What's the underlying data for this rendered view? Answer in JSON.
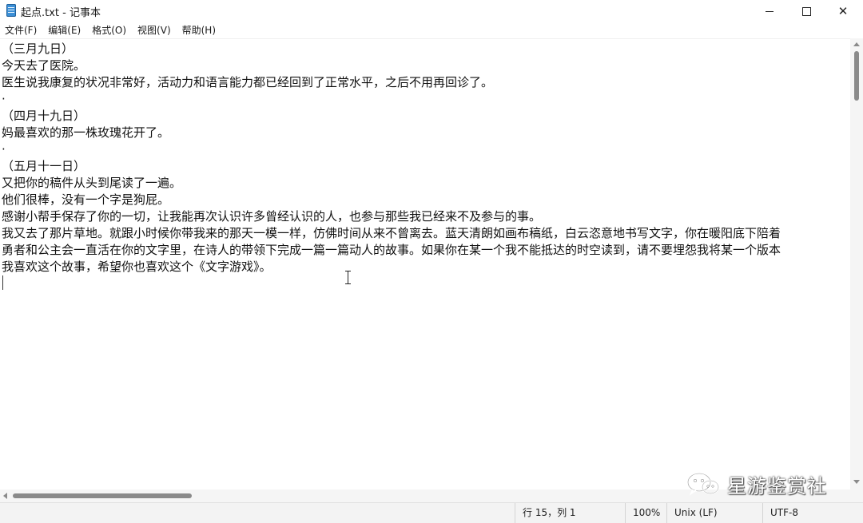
{
  "window": {
    "title": "起点.txt - 记事本",
    "controls": {
      "minimize_icon": "minimize-icon",
      "maximize_icon": "maximize-icon",
      "close_glyph": "✕"
    }
  },
  "menu": {
    "items": [
      {
        "label": "文件(F)"
      },
      {
        "label": "编辑(E)"
      },
      {
        "label": "格式(O)"
      },
      {
        "label": "视图(V)"
      },
      {
        "label": "帮助(H)"
      }
    ]
  },
  "document": {
    "lines": [
      "（三月九日）",
      "今天去了医院。",
      "医生说我康复的状况非常好，活动力和语言能力都已经回到了正常水平，之后不用再回诊了。",
      "·",
      "（四月十九日）",
      "妈最喜欢的那一株玫瑰花开了。",
      "·",
      "（五月十一日）",
      "又把你的稿件从头到尾读了一遍。",
      "他们很棒，没有一个字是狗屁。",
      "感谢小帮手保存了你的一切，让我能再次认识许多曾经认识的人，也参与那些我已经来不及参与的事。",
      "我又去了那片草地。就跟小时候你带我来的那天一模一样，仿佛时间从来不曾离去。蓝天清朗如画布稿纸，白云恣意地书写文字，你在暖阳底下陪着",
      "勇者和公主会一直活在你的文字里，在诗人的带领下完成一篇一篇动人的故事。如果你在某一个我不能抵达的时空读到，请不要埋怨我将某一个版本",
      "我喜欢这个故事，希望你也喜欢这个《文字游戏》。"
    ]
  },
  "statusbar": {
    "position": "行 15，列 1",
    "zoom": "100%",
    "line_ending": "Unix (LF)",
    "encoding": "UTF-8"
  },
  "watermark": {
    "text": "星游鉴赏社"
  }
}
